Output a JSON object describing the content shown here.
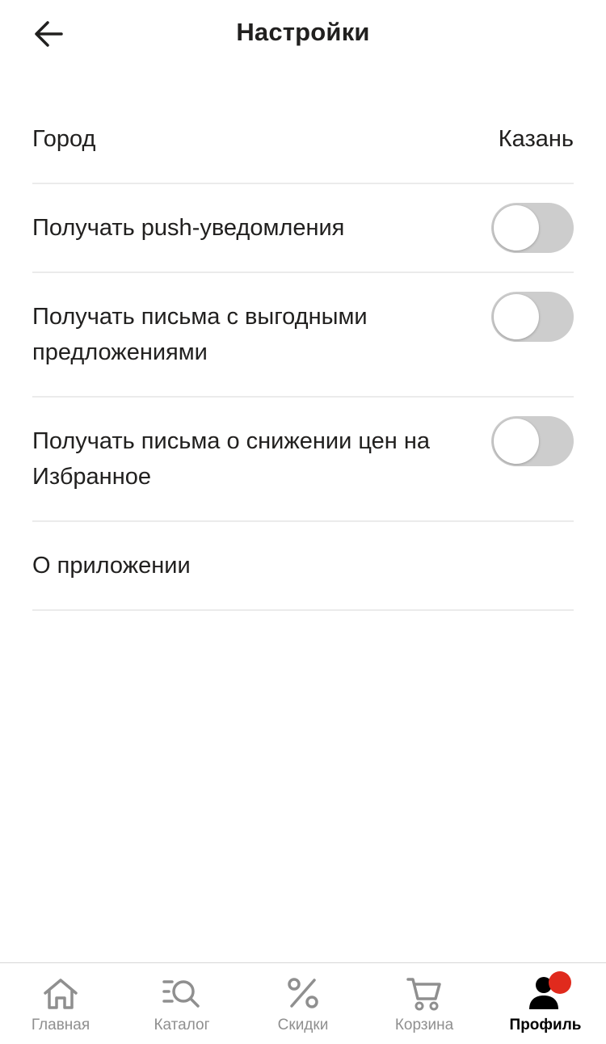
{
  "header": {
    "title": "Настройки",
    "back_icon": "arrow-left-icon"
  },
  "settings": {
    "city": {
      "label": "Город",
      "value": "Казань"
    },
    "push": {
      "label": "Получать push-уведомления",
      "enabled": false
    },
    "offers": {
      "label": "Получать письма с выгодными предложениями",
      "enabled": false
    },
    "price_drop": {
      "label": "Получать письма о снижении цен на Избранное",
      "enabled": false
    },
    "about": {
      "label": "О приложении"
    }
  },
  "tabbar": {
    "items": [
      {
        "label": "Главная",
        "icon": "home-icon",
        "active": false
      },
      {
        "label": "Каталог",
        "icon": "catalog-search-icon",
        "active": false
      },
      {
        "label": "Скидки",
        "icon": "percent-icon",
        "active": false
      },
      {
        "label": "Корзина",
        "icon": "cart-icon",
        "active": false
      },
      {
        "label": "Профиль",
        "icon": "profile-icon",
        "active": true,
        "badge": true
      }
    ]
  },
  "colors": {
    "toggle_off": "#cdcdcd",
    "badge": "#e02a1d",
    "tab_inactive": "#8f8f8f",
    "divider": "#ebebeb"
  }
}
